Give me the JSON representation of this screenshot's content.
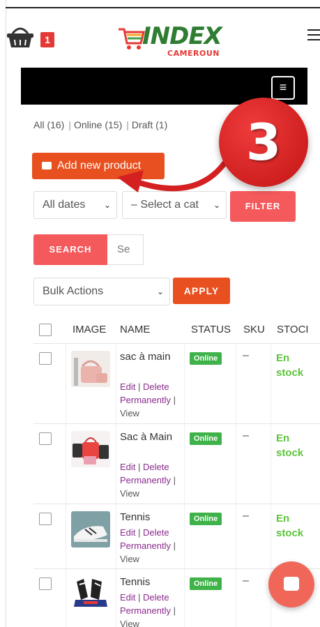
{
  "header": {
    "cart_count": "1",
    "logo_main": "INDEX",
    "logo_sub": "CAMEROUN"
  },
  "filters": {
    "all": "All (16)",
    "online": "Online (15)",
    "draft": "Draft (1)"
  },
  "toolbar": {
    "add_new_label": "Add new product",
    "dates_value": "All dates",
    "category_value": "– Select a cat",
    "filter_label": "FILTER",
    "search_label": "SEARCH",
    "search_placeholder": "Se",
    "bulk_value": "Bulk Actions",
    "apply_label": "APPLY"
  },
  "table": {
    "headers": {
      "image": "IMAGE",
      "name": "NAME",
      "status": "STATUS",
      "sku": "SKU",
      "stock": "STOCI"
    },
    "actions": {
      "edit": "Edit",
      "sep": " | ",
      "delete": "Delete Permanently",
      "view": "View"
    },
    "rows": [
      {
        "name": "sac à main",
        "status": "Online",
        "sku": "–",
        "stock": "En stock"
      },
      {
        "name": "Sac à Main",
        "status": "Online",
        "sku": "–",
        "stock": "En stock"
      },
      {
        "name": "Tennis",
        "status": "Online",
        "sku": "–",
        "stock": "En stock"
      },
      {
        "name": "Tennis",
        "status": "Online",
        "sku": "–",
        "stock": ""
      }
    ]
  },
  "annotation": {
    "step_number": "3"
  },
  "colors": {
    "accent_orange": "#e8501f",
    "button_red": "#f4595c",
    "online_green": "#3fb24a",
    "stock_green": "#5cc43c",
    "link_purple": "#8b2a8e",
    "annotation_red": "#d42020"
  }
}
